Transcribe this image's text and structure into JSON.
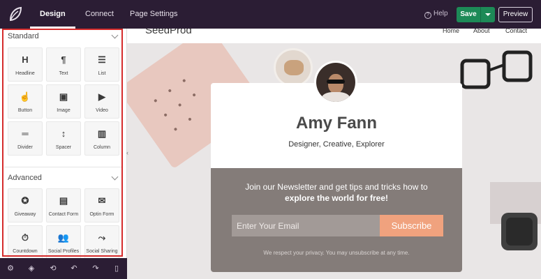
{
  "topbar": {
    "tabs": [
      "Design",
      "Connect",
      "Page Settings"
    ],
    "help_label": "Help",
    "help_icon": "?",
    "save_label": "Save",
    "preview_label": "Preview"
  },
  "sidebar": {
    "standard_title": "Standard",
    "advanced_title": "Advanced",
    "standard_blocks": [
      {
        "label": "Headline",
        "icon": "H"
      },
      {
        "label": "Text",
        "icon": "¶"
      },
      {
        "label": "List",
        "icon": "☰"
      },
      {
        "label": "Button",
        "icon": "☝"
      },
      {
        "label": "Image",
        "icon": "▣"
      },
      {
        "label": "Video",
        "icon": "▶"
      },
      {
        "label": "Divider",
        "icon": "═"
      },
      {
        "label": "Spacer",
        "icon": "↕"
      },
      {
        "label": "Column",
        "icon": "▥"
      }
    ],
    "advanced_blocks": [
      {
        "label": "Giveaway",
        "icon": "✪"
      },
      {
        "label": "Contact Form",
        "icon": "▤"
      },
      {
        "label": "Optin Form",
        "icon": "✉"
      },
      {
        "label": "Countdown",
        "icon": "⏱"
      },
      {
        "label": "Social Profiles",
        "icon": "👥"
      },
      {
        "label": "Social Sharing",
        "icon": "⤳"
      }
    ]
  },
  "bottombar": {
    "icons": [
      "gear-icon",
      "layers-icon",
      "history-icon",
      "undo-icon",
      "redo-icon",
      "mobile-preview-icon"
    ],
    "glyphs": [
      "⚙",
      "◈",
      "⟲",
      "↶",
      "↷",
      "▯"
    ]
  },
  "site": {
    "logo_text": "SeedProd",
    "nav": [
      "Home",
      "About",
      "Contact"
    ]
  },
  "card": {
    "name": "Amy Fann",
    "tagline": "Designer, Creative, Explorer",
    "newsletter_line1": "Join our Newsletter and get tips and tricks how to",
    "newsletter_line2": "explore the world for free!",
    "email_placeholder": "Enter Your Email",
    "subscribe_label": "Subscribe",
    "privacy_text": "We respect your privacy. You may unsubscribe at any time."
  },
  "colors": {
    "topbar": "#2b1d34",
    "save": "#1d8a57",
    "highlight": "#d52b2b",
    "subscribe": "#f0a27e",
    "newsletter_bg": "#847c79"
  }
}
